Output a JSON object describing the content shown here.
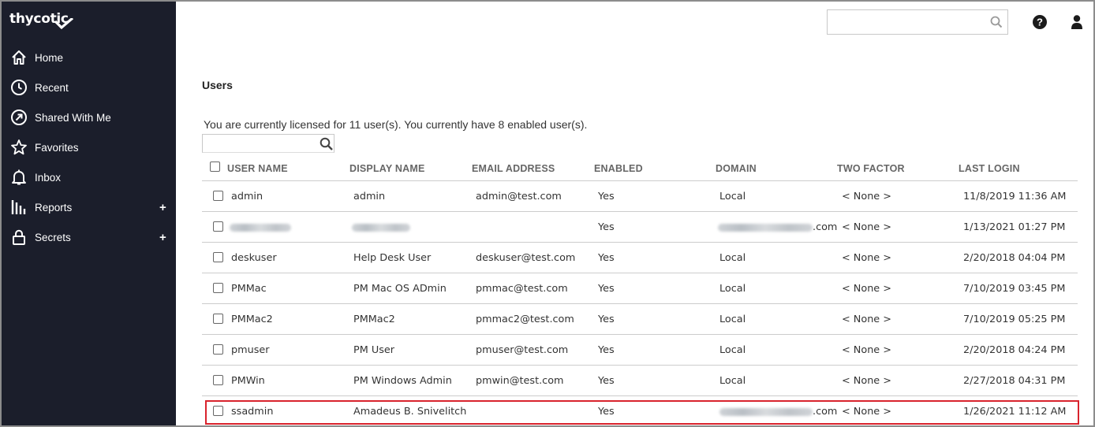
{
  "app": {
    "logo_text": "thycotic"
  },
  "sidebar": {
    "items": [
      {
        "label": "Home",
        "icon": "home-icon",
        "expandable": false
      },
      {
        "label": "Recent",
        "icon": "clock-icon",
        "expandable": false
      },
      {
        "label": "Shared With Me",
        "icon": "share-arrow-icon",
        "expandable": false
      },
      {
        "label": "Favorites",
        "icon": "star-icon",
        "expandable": false
      },
      {
        "label": "Inbox",
        "icon": "bell-icon",
        "expandable": false
      },
      {
        "label": "Reports",
        "icon": "bar-chart-icon",
        "expandable": true
      },
      {
        "label": "Secrets",
        "icon": "lock-icon",
        "expandable": true
      }
    ],
    "plus_symbol": "+"
  },
  "header": {
    "search_value": "",
    "help_icon": "help-icon",
    "user_icon": "user-icon"
  },
  "page": {
    "title": "Users",
    "license_text": "You are currently licensed for 11 user(s). You currently have 8 enabled user(s).",
    "filter_value": ""
  },
  "table": {
    "columns": [
      "USER NAME",
      "DISPLAY NAME",
      "EMAIL ADDRESS",
      "ENABLED",
      "DOMAIN",
      "TWO FACTOR",
      "LAST LOGIN"
    ],
    "rows": [
      {
        "username": "admin",
        "display": "admin",
        "email": "admin@test.com",
        "enabled": "Yes",
        "domain": "Local",
        "two_factor": "< None >",
        "last_login": "11/8/2019 11:36 AM"
      },
      {
        "username": "",
        "display": "",
        "email": "",
        "enabled": "Yes",
        "domain": ".com",
        "two_factor": "< None >",
        "last_login": "1/13/2021 01:27 PM",
        "redacted": true
      },
      {
        "username": "deskuser",
        "display": "Help Desk User",
        "email": "deskuser@test.com",
        "enabled": "Yes",
        "domain": "Local",
        "two_factor": "< None >",
        "last_login": "2/20/2018 04:04 PM"
      },
      {
        "username": "PMMac",
        "display": "PM Mac OS ADmin",
        "email": "pmmac@test.com",
        "enabled": "Yes",
        "domain": "Local",
        "two_factor": "< None >",
        "last_login": "7/10/2019 03:45 PM"
      },
      {
        "username": "PMMac2",
        "display": "PMMac2",
        "email": "pmmac2@test.com",
        "enabled": "Yes",
        "domain": "Local",
        "two_factor": "< None >",
        "last_login": "7/10/2019 05:25 PM"
      },
      {
        "username": "pmuser",
        "display": "PM User",
        "email": "pmuser@test.com",
        "enabled": "Yes",
        "domain": "Local",
        "two_factor": "< None >",
        "last_login": "2/20/2018 04:24 PM"
      },
      {
        "username": "PMWin",
        "display": "PM Windows Admin",
        "email": "pmwin@test.com",
        "enabled": "Yes",
        "domain": "Local",
        "two_factor": "< None >",
        "last_login": "2/27/2018 04:31 PM"
      },
      {
        "username": "ssadmin",
        "display": "Amadeus B. Snivelitch",
        "email": "",
        "enabled": "Yes",
        "domain": ".com",
        "two_factor": "< None >",
        "last_login": "1/26/2021 11:12 AM",
        "highlighted": true
      }
    ]
  },
  "colors": {
    "sidebar_bg": "#1b1e2b",
    "highlight_border": "#d9232d"
  }
}
